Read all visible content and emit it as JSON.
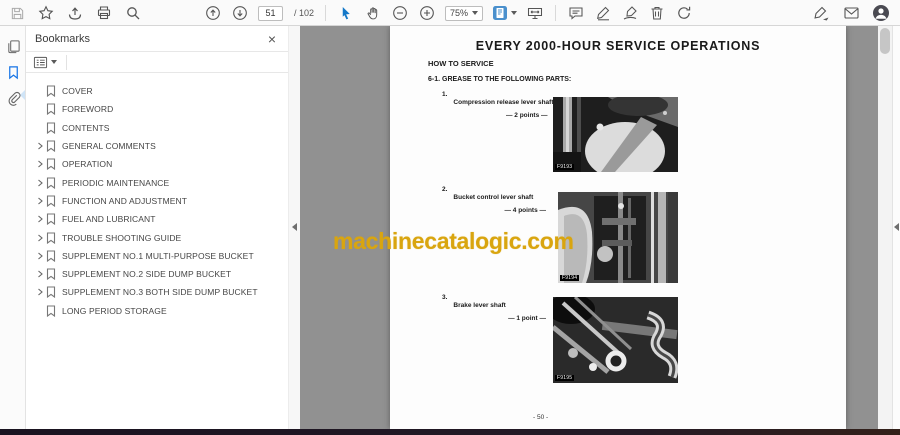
{
  "toolbar": {
    "page_current": "51",
    "page_total": "/ 102",
    "zoom_level": "75%",
    "left_icons": [
      "save-icon",
      "star-icon",
      "share-icon",
      "print-icon",
      "search-icon"
    ],
    "nav_icons": [
      "page-up-icon",
      "page-down-icon",
      "select-tool-icon",
      "hand-tool-icon",
      "zoom-out-icon",
      "zoom-in-icon",
      "page-view-mode-icon",
      "fit-width-icon"
    ],
    "annotate_icons": [
      "comment-icon",
      "highlight-icon",
      "sign-icon",
      "trash-icon",
      "refresh-icon"
    ],
    "right_icons": [
      "fill-sign-icon",
      "email-icon",
      "profile-icon"
    ]
  },
  "rail": {
    "icons": [
      "page-thumbnails-icon",
      "bookmarks-icon",
      "attachments-icon"
    ],
    "active": "bookmarks-icon"
  },
  "bookmarks_panel": {
    "title": "Bookmarks",
    "close_icon": "×",
    "options_icon": "bookmark-options-icon",
    "items": [
      {
        "label": "COVER",
        "expandable": false
      },
      {
        "label": "FOREWORD",
        "expandable": false
      },
      {
        "label": "CONTENTS",
        "expandable": false
      },
      {
        "label": "GENERAL COMMENTS",
        "expandable": true
      },
      {
        "label": "OPERATION",
        "expandable": true
      },
      {
        "label": "PERIODIC MAINTENANCE",
        "expandable": true
      },
      {
        "label": "FUNCTION AND ADJUSTMENT",
        "expandable": true
      },
      {
        "label": "FUEL AND LUBRICANT",
        "expandable": true
      },
      {
        "label": "TROUBLE SHOOTING GUIDE",
        "expandable": true
      },
      {
        "label": "SUPPLEMENT NO.1 MULTI-PURPOSE BUCKET",
        "expandable": true
      },
      {
        "label": "SUPPLEMENT NO.2 SIDE DUMP BUCKET",
        "expandable": true
      },
      {
        "label": "SUPPLEMENT NO.3 BOTH SIDE DUMP BUCKET",
        "expandable": true
      },
      {
        "label": "LONG PERIOD STORAGE",
        "expandable": false
      }
    ]
  },
  "document": {
    "title": "EVERY 2000-HOUR SERVICE OPERATIONS",
    "how_to": "HOW TO SERVICE",
    "section": "6-1.  GREASE TO THE FOLLOWING PARTS:",
    "items": [
      {
        "num": "1.",
        "label": "Compression release lever shaft",
        "points": "— 2 points —",
        "figure": "F9193"
      },
      {
        "num": "2.",
        "label": "Bucket control lever shaft",
        "points": "— 4 points —",
        "figure": "F9194"
      },
      {
        "num": "3.",
        "label": "Brake lever shaft",
        "points": "— 1 point —",
        "figure": "F9195"
      }
    ],
    "page_number": "- 50 -",
    "watermark": "machinecatalogic.com"
  },
  "colors": {
    "accent_blue": "#1473e6",
    "viewer_background": "#919191",
    "watermark_orange": "#d9a50f",
    "bottom_bar": "#1c1424"
  }
}
